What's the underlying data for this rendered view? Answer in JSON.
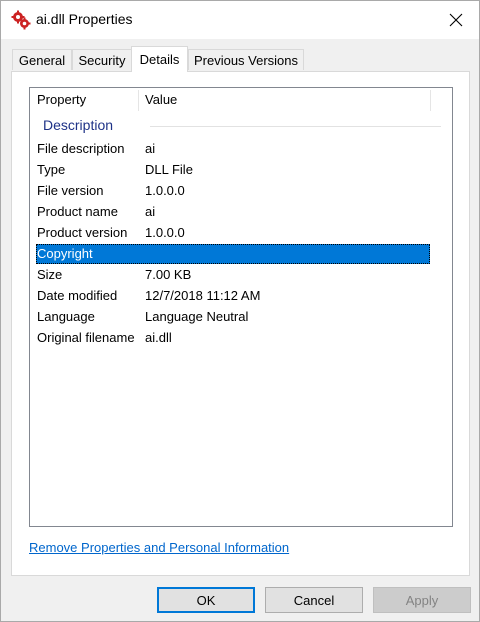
{
  "window": {
    "title": "ai.dll Properties",
    "icon": "gears-icon"
  },
  "tabs": [
    {
      "label": "General"
    },
    {
      "label": "Security"
    },
    {
      "label": "Details",
      "active": true
    },
    {
      "label": "Previous Versions"
    }
  ],
  "details": {
    "columns": {
      "property": "Property",
      "value": "Value"
    },
    "group_title": "Description",
    "rows": [
      {
        "property": "File description",
        "value": "ai"
      },
      {
        "property": "Type",
        "value": "DLL File"
      },
      {
        "property": "File version",
        "value": "1.0.0.0"
      },
      {
        "property": "Product name",
        "value": "ai"
      },
      {
        "property": "Product version",
        "value": "1.0.0.0"
      },
      {
        "property": "Copyright",
        "value": "",
        "selected": true
      },
      {
        "property": "Size",
        "value": "7.00 KB"
      },
      {
        "property": "Date modified",
        "value": "12/7/2018 11:12 AM"
      },
      {
        "property": "Language",
        "value": "Language Neutral"
      },
      {
        "property": "Original filename",
        "value": "ai.dll"
      }
    ]
  },
  "remove_link": "Remove Properties and Personal Information",
  "buttons": {
    "ok": "OK",
    "cancel": "Cancel",
    "apply": "Apply"
  },
  "colors": {
    "selection": "#0078d7",
    "link": "#0066cc",
    "group_header": "#1e3287"
  }
}
